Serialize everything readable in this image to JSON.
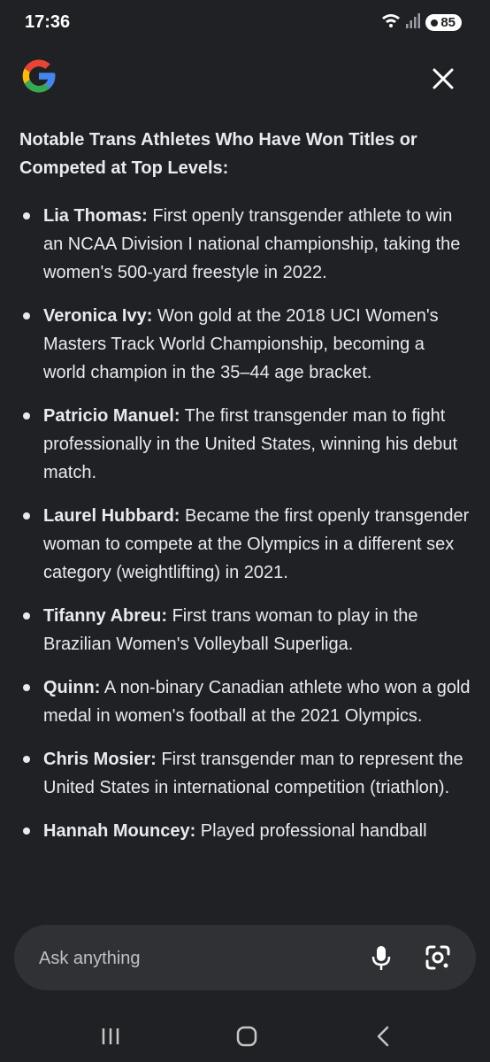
{
  "status_bar": {
    "time": "17:36",
    "battery": "85",
    "icons": [
      "wifi-icon",
      "signal-icon",
      "battery-icon"
    ]
  },
  "header": {
    "logo_icon": "google-g-icon",
    "close_icon": "close-icon"
  },
  "content": {
    "heading": "Notable Trans Athletes Who Have Won Titles or Competed at Top Levels:",
    "items": [
      {
        "name": "Lia Thomas:",
        "text": " First openly transgender athlete to win an NCAA Division I national championship, taking the women's 500-yard freestyle in 2022."
      },
      {
        "name": "Veronica Ivy:",
        "text": " Won gold at the 2018 UCI Women's Masters Track World Championship, becoming a world champion in the 35–44 age bracket."
      },
      {
        "name": "Patricio Manuel:",
        "text": " The first transgender man to fight professionally in the United States, winning his debut match."
      },
      {
        "name": "Laurel Hubbard:",
        "text": " Became the first openly transgender woman to compete at the Olympics in a different sex category (weightlifting) in 2021."
      },
      {
        "name": "Tifanny Abreu:",
        "text": " First trans woman to play in the Brazilian Women's Volleyball Superliga."
      },
      {
        "name": "Quinn:",
        "text": " A non-binary Canadian athlete who won a gold medal in women's football at the 2021 Olympics."
      },
      {
        "name": "Chris Mosier:",
        "text": " First transgender man to represent the United States in international competition (triathlon)."
      },
      {
        "name": "Hannah Mouncey:",
        "text": " Played professional handball"
      }
    ]
  },
  "ask_bar": {
    "placeholder": "Ask anything",
    "mic_icon": "microphone-icon",
    "lens_icon": "google-lens-icon"
  },
  "nav": {
    "icons": [
      "recent-apps-icon",
      "home-icon",
      "back-icon"
    ]
  },
  "colors": {
    "background": "#202124",
    "text": "#e8eaed",
    "input_bg": "#303134",
    "google_blue": "#4285F4",
    "google_red": "#EA4335",
    "google_yellow": "#FBBC05",
    "google_green": "#34A853"
  }
}
